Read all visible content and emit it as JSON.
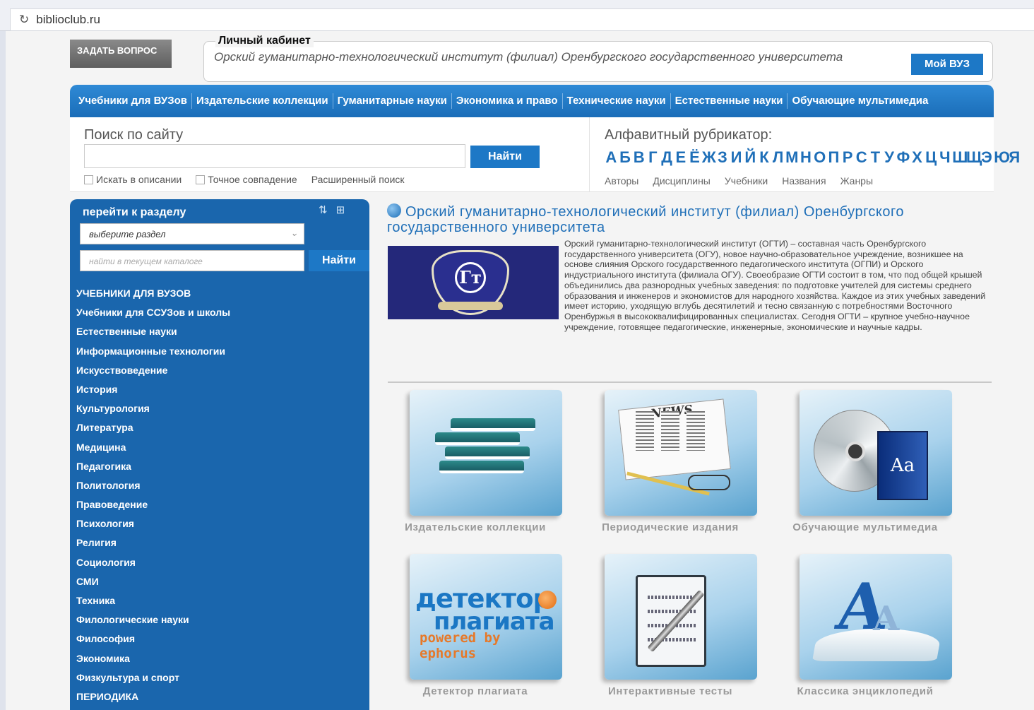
{
  "browser": {
    "url": "biblioclub.ru"
  },
  "header": {
    "ask_button": "ЗАДАТЬ ВОПРОС",
    "cabinet_legend": "Личный кабинет",
    "institution": "Орский гуманитарно-технологический институт (филиал) Оренбургского государственного университета",
    "my_vuz_button": "Мой ВУЗ"
  },
  "topnav": [
    "Учебники для ВУЗов",
    "Издательские коллекции",
    "Гуманитарные науки",
    "Экономика и право",
    "Технические науки",
    "Естественные науки",
    "Обучающие мультимедиа"
  ],
  "search": {
    "label": "Поиск по сайту",
    "value": "",
    "button": "Найти",
    "opt_descriptions": "Искать в описании",
    "opt_exact": "Точное совпадение",
    "advanced": "Расширенный поиск"
  },
  "alphabet": {
    "label": "Алфавитный рубрикатор:",
    "letters": [
      "А",
      "Б",
      "В",
      "Г",
      "Д",
      "Е",
      "Ё",
      "Ж",
      "З",
      "И",
      "Й",
      "К",
      "Л",
      "М",
      "Н",
      "О",
      "П",
      "Р",
      "С",
      "Т",
      "У",
      "Ф",
      "Х",
      "Ц",
      "Ч",
      "Ш",
      "Щ",
      "Э",
      "Ю",
      "Я"
    ],
    "links": [
      "Авторы",
      "Дисциплины",
      "Учебники",
      "Названия",
      "Жанры"
    ]
  },
  "sidebar": {
    "heading": "перейти к разделу",
    "select_value": "выберите раздел",
    "find_placeholder": "найти в текущем каталоге",
    "find_button": "Найти",
    "items": [
      "УЧЕБНИКИ ДЛЯ ВУЗОВ",
      "Учебники для ССУЗов и школы",
      "Естественные науки",
      "Информационные технологии",
      "Искусствоведение",
      "История",
      "Культурология",
      "Литература",
      "Медицина",
      "Педагогика",
      "Политология",
      "Правоведение",
      "Психология",
      "Религия",
      "Социология",
      "СМИ",
      "Техника",
      "Филологические науки",
      "Философия",
      "Экономика",
      "Физкультура и спорт",
      "ПЕРИОДИКА"
    ]
  },
  "main": {
    "title": "Орский гуманитарно-технологический институт (филиал) Оренбургского государственного университета",
    "description": "Орский гуманитарно-технологический институт (ОГТИ) – составная часть Оренбургского государственного университета (ОГУ), новое научно-образовательное учреждение, возникшее на основе слияния Орского государственного педагогического института (ОГПИ) и Орского индустриального института (филиала ОГУ). Своеобразие ОГТИ состоит в том, что под общей крышей объединились два разнородных учебных заведения: по подготовке учителей для системы среднего образования и инженеров и экономистов для народного хозяйства. Каждое из этих учебных заведений имеет историю, уходящую вглубь десятилетий и тесно связанную с потребностями Восточного Оренбуржья в высококвалифицированных специалистах. Сегодня ОГТИ – крупное учебно-научное учреждение, готовящее педагогические, инженерные, экономические и научные кадры.",
    "logo_text": "Гт",
    "tiles": [
      {
        "caption": "Издательские коллекции",
        "icon": "books-icon"
      },
      {
        "caption": "Периодические издания",
        "icon": "newspaper-icon"
      },
      {
        "caption": "Обучающие мультимедиа",
        "icon": "cd-dictionary-icon"
      },
      {
        "caption": "Детектор плагиата",
        "icon": "plagiarism-detector-icon"
      },
      {
        "caption": "Интерактивные тесты",
        "icon": "clipboard-test-icon"
      },
      {
        "caption": "Классика энциклопедий",
        "icon": "encyclopedia-icon"
      }
    ],
    "news_word": "NEWS",
    "plag": {
      "line1": "детектор",
      "line2": "плагиата",
      "line3": "powered by ephorus"
    },
    "media_book_label": "Aa",
    "encyc_label_big": "A",
    "encyc_label_small": "A"
  },
  "colors": {
    "accent": "#1d78c6",
    "nav": "#1a6db8",
    "sidebar": "#1a66ad",
    "title": "#1f6fb8"
  }
}
